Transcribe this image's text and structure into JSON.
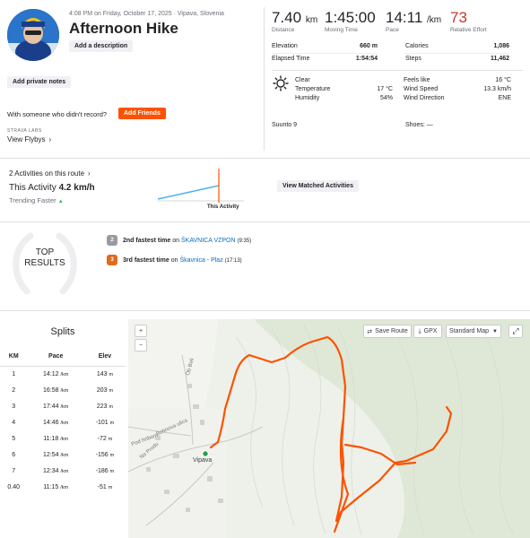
{
  "activity": {
    "datetime_location": "4:08 PM on Friday, October 17, 2025 · Vipava, Slovenia",
    "title": "Afternoon Hike",
    "add_description_label": "Add a description",
    "add_private_notes_label": "Add private notes",
    "someone_prompt": "With someone who didn't record?",
    "add_friends_label": "Add Friends",
    "strava_labs_label": "STRAVA LABS",
    "view_flybys_label": "View Flybys"
  },
  "stats": {
    "distance": {
      "value": "7.40",
      "unit": "km",
      "label": "Distance"
    },
    "moving_time": {
      "value": "1:45:00",
      "label": "Moving Time"
    },
    "pace": {
      "value": "14:11",
      "unit": "/km",
      "label": "Pace"
    },
    "relative_effort": {
      "value": "73",
      "label": "Relative Effort"
    },
    "elevation": {
      "label": "Elevation",
      "value": "660 m"
    },
    "elapsed_time": {
      "label": "Elapsed Time",
      "value": "1:54:54"
    },
    "calories": {
      "label": "Calories",
      "value": "1,086"
    },
    "steps": {
      "label": "Steps",
      "value": "11,462"
    }
  },
  "weather": {
    "condition": "Clear",
    "temperature": {
      "label": "Temperature",
      "value": "17 °C"
    },
    "humidity": {
      "label": "Humidity",
      "value": "54%"
    },
    "feels_like": {
      "label": "Feels like",
      "value": "16 °C"
    },
    "wind_speed": {
      "label": "Wind Speed",
      "value": "13.3 km/h"
    },
    "wind_direction": {
      "label": "Wind Direction",
      "value": "ENE"
    }
  },
  "device": "Suunto 9",
  "shoes": "Shoes: —",
  "route": {
    "activities_on_route": "2 Activities on this route",
    "this_activity_label": "This Activity",
    "this_activity_speed": "4.2 km/h",
    "trend": "Trending Faster",
    "chart_marker_label": "This Activity",
    "view_matched_label": "View Matched Activities"
  },
  "top_results": {
    "heading_line1": "TOP",
    "heading_line2": "RESULTS",
    "items": [
      {
        "rank": "2nd fastest time",
        "on": "on",
        "segment": "ŠKAVNICA VZPON",
        "time": "(9:35)",
        "medal_color": "#9a9aa3"
      },
      {
        "rank": "3rd fastest time",
        "on": "on",
        "segment": "Škavnica - Plaz",
        "time": "(17:13)",
        "medal_color": "#e06a1b"
      }
    ]
  },
  "splits": {
    "title": "Splits",
    "headers": [
      "KM",
      "Pace",
      "Elev"
    ],
    "rows": [
      {
        "km": "1",
        "pace": "14:12",
        "pace_unit": "/km",
        "elev": "143",
        "elev_unit": "m"
      },
      {
        "km": "2",
        "pace": "16:58",
        "pace_unit": "/km",
        "elev": "203",
        "elev_unit": "m"
      },
      {
        "km": "3",
        "pace": "17:44",
        "pace_unit": "/km",
        "elev": "223",
        "elev_unit": "m"
      },
      {
        "km": "4",
        "pace": "14:46",
        "pace_unit": "/km",
        "elev": "-101",
        "elev_unit": "m"
      },
      {
        "km": "5",
        "pace": "11:18",
        "pace_unit": "/km",
        "elev": "-72",
        "elev_unit": "m"
      },
      {
        "km": "6",
        "pace": "12:54",
        "pace_unit": "/km",
        "elev": "-156",
        "elev_unit": "m"
      },
      {
        "km": "7",
        "pace": "12:34",
        "pace_unit": "/km",
        "elev": "-186",
        "elev_unit": "m"
      },
      {
        "km": "0.40",
        "pace": "11:15",
        "pace_unit": "/km",
        "elev": "-51",
        "elev_unit": "m"
      }
    ]
  },
  "map": {
    "zoom_in": "+",
    "zoom_out": "−",
    "save_route_label": "Save Route",
    "gpx_label": "GPX",
    "map_type_label": "Standard Map",
    "town_label": "Vipava",
    "street_labels": [
      "Ob Beli",
      "Pod hribom",
      "Bobnova ulica",
      "Na Produ"
    ],
    "route_color": "#fc5200",
    "accent": "#fc5200"
  },
  "colors": {
    "accent": "#fc5200",
    "relative_effort": "#c0392b",
    "trend_line": "#4fb3e8",
    "trend_up": "#3cb371"
  }
}
